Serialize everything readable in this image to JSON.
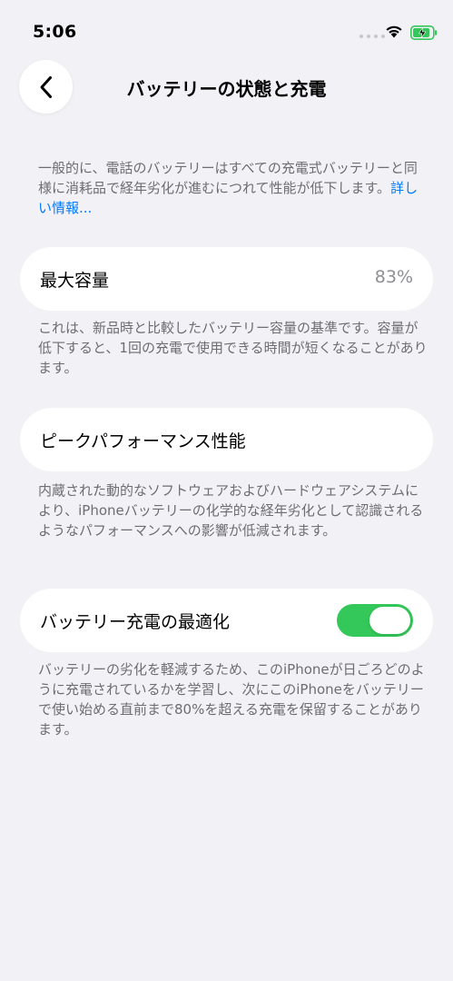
{
  "status_bar": {
    "time": "5:06"
  },
  "nav": {
    "title": "バッテリーの状態と充電"
  },
  "intro": {
    "text": "一般的に、電話のバッテリーはすべての充電式バッテリーと同様に消耗品で経年劣化が進むにつれて性能が低下します。",
    "link": "詳しい情報..."
  },
  "max_capacity": {
    "label": "最大容量",
    "value": "83%",
    "footnote": "これは、新品時と比較したバッテリー容量の基準です。容量が低下すると、1回の充電で使用できる時間が短くなることがあります。"
  },
  "peak_performance": {
    "label": "ピークパフォーマンス性能",
    "footnote": "内蔵された動的なソフトウェアおよびハードウェアシステムにより、iPhoneバッテリーの化学的な経年劣化として認識されるようなパフォーマンスへの影響が低減されます。"
  },
  "optimized_charging": {
    "label": "バッテリー充電の最適化",
    "enabled": true,
    "footnote": "バッテリーの劣化を軽減するため、このiPhoneが日ごろどのように充電されているかを学習し、次にこのiPhoneをバッテリーで使い始める直前まで80%を超える充電を保留することがあります。"
  },
  "colors": {
    "background": "#f2f1f6",
    "card": "#ffffff",
    "secondary_text": "#6d6d72",
    "link": "#007aff",
    "toggle_on": "#34c759",
    "battery_charging": "#34c759"
  },
  "icons": {
    "back": "chevron-left-icon",
    "wifi": "wifi-icon",
    "battery": "battery-charging-icon",
    "cellular": "cellular-dots-icon"
  }
}
